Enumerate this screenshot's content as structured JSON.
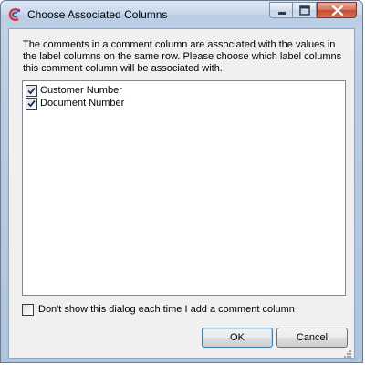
{
  "window": {
    "title": "Choose Associated Columns"
  },
  "icons": {
    "app": "app-logo-icon",
    "minimize": "minimize-icon",
    "maximize": "maximize-icon",
    "close": "close-icon",
    "check": "checkmark-icon",
    "grip": "resize-grip-icon"
  },
  "dialog": {
    "instructions": "The comments in a comment column are associated with the values in the label columns on the same row. Please choose which label columns this comment column will be associated with.",
    "columns": [
      {
        "label": "Customer Number",
        "checked": true
      },
      {
        "label": "Document Number",
        "checked": true
      }
    ],
    "dont_show_label": "Don't show this dialog each time I add a comment column",
    "dont_show_checked": false,
    "ok_label": "OK",
    "cancel_label": "Cancel"
  },
  "colors": {
    "accent": "#3c7fb1",
    "close_button": "#c64a2f"
  }
}
